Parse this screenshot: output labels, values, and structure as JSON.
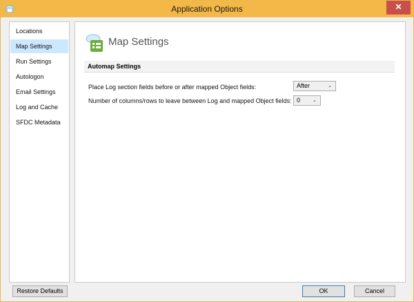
{
  "window": {
    "title": "Application Options",
    "close_glyph": "✕"
  },
  "nav": {
    "items": [
      {
        "label": "Locations"
      },
      {
        "label": "Map Settings",
        "selected": true
      },
      {
        "label": "Run Settings"
      },
      {
        "label": "Autologon"
      },
      {
        "label": "Email Settings"
      },
      {
        "label": "Log and Cache"
      },
      {
        "label": "SFDC Metadata"
      }
    ]
  },
  "page": {
    "title": "Map Settings",
    "icon": "map-settings-icon",
    "section": "Automap Settings",
    "fields": [
      {
        "label": "Place Log section fields before or after mapped Object fields:",
        "value": "After"
      },
      {
        "label": "Number of columns/rows to leave between Log and mapped Object fields:",
        "value": "0"
      }
    ]
  },
  "footer": {
    "restore_label": "Restore Defaults",
    "ok_label": "OK",
    "cancel_label": "Cancel"
  },
  "colors": {
    "titlebar": "#f3b847",
    "selection": "#cce8ff",
    "close": "#c7504a"
  }
}
